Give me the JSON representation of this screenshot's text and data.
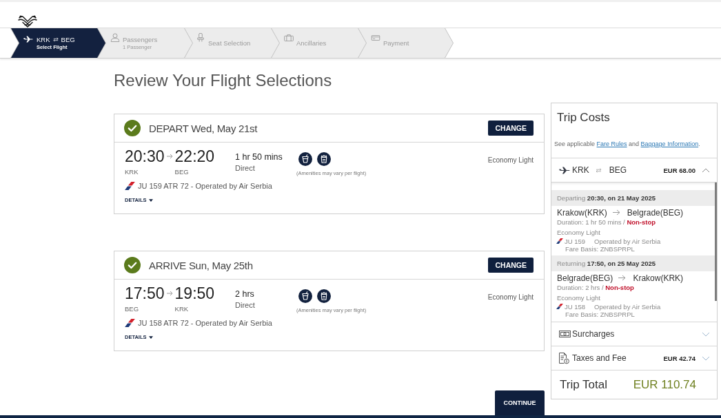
{
  "steps": [
    {
      "kind": "flight",
      "from": "KRK",
      "to": "BEG",
      "subtitle": "Select Flight",
      "selected": true
    },
    {
      "kind": "passengers",
      "label": "Passengers",
      "subtitle": "1 Passenger",
      "selected": false
    },
    {
      "kind": "seat",
      "label": "Seat Selection",
      "selected": false
    },
    {
      "kind": "ancillaries",
      "label": "Ancillaries",
      "selected": false
    },
    {
      "kind": "payment",
      "label": "Payment",
      "selected": false
    }
  ],
  "page_title": "Review Your Flight Selections",
  "flights": [
    {
      "confirmed": true,
      "heading": "DEPART Wed, May 21st",
      "change_button": "CHANGE",
      "departure_time": "20:30",
      "origin": "KRK",
      "arrival_time": "22:20",
      "destination": "BEG",
      "duration": "1 hr 50 mins",
      "stops": "Direct",
      "amenities_note": "(Amenities may vary per flight)",
      "cabin": "Economy Light",
      "flight_info": "JU 159 ATR 72 - Operated by Air Serbia",
      "details_toggle": "DETAILS"
    },
    {
      "confirmed": true,
      "heading": "ARRIVE Sun, May 25th",
      "change_button": "CHANGE",
      "departure_time": "17:50",
      "origin": "BEG",
      "arrival_time": "19:50",
      "destination": "KRK",
      "duration": "2 hrs",
      "stops": "Direct",
      "amenities_note": "(Amenities may vary per flight)",
      "cabin": "Economy Light",
      "flight_info": "JU 158 ATR 72 - Operated by Air Serbia",
      "details_toggle": "DETAILS"
    }
  ],
  "continue_button": "CONTINUE",
  "trip_costs": {
    "title": "Trip Costs",
    "note": {
      "lead": "See applicable",
      "fare_rules_link": "Fare Rules",
      "joiner": "and",
      "baggage_link": "Baggage Information",
      "end": "."
    },
    "route": {
      "from": "KRK",
      "to": "BEG",
      "price": "EUR 68.00",
      "expanded": true
    },
    "segments": [
      {
        "when": "Departing **20:30, on 21 May 2025**",
        "from": "Krakow(KRK)",
        "to": "Belgrade(BEG)",
        "duration": "Duration: 1 hr 50 mins / **Non-stop**",
        "cabin": "Economy Light",
        "flight": "JU 159",
        "operator": "Operated by Air Serbia",
        "fare_basis": "Fare Basis: ZNBSPRPL"
      },
      {
        "when": "Returning **17:50, on 25 May 2025**",
        "from": "Belgrade(BEG)",
        "to": "Krakow(KRK)",
        "duration": "Duration: 2 hrs / **Non-stop**",
        "cabin": "Economy Light",
        "flight": "JU 158",
        "operator": "Operated by Air Serbia",
        "fare_basis": "Fare Basis: ZNBSPRPL"
      }
    ],
    "charges": [
      {
        "kind": "surcharges",
        "label": "Surcharges",
        "expanded": false
      },
      {
        "kind": "taxes",
        "label": "Taxes and Fee",
        "amount": "EUR 42.74",
        "expanded": false
      }
    ],
    "total": {
      "label": "Trip Total",
      "amount": "EUR 110.74"
    }
  }
}
